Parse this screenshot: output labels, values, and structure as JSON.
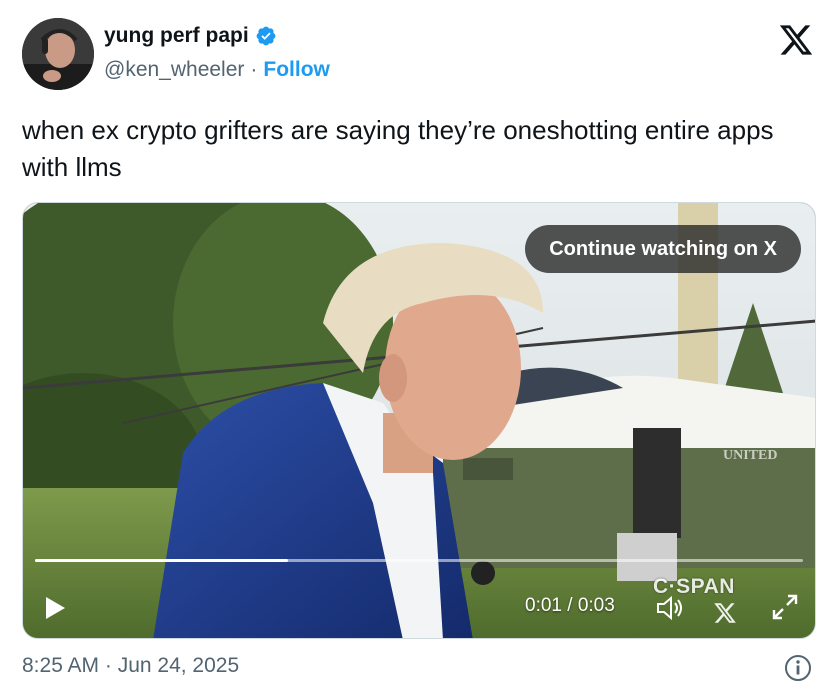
{
  "author": {
    "display_name": "yung perf papi",
    "handle": "@ken_wheeler",
    "separator": "·",
    "follow_label": "Follow",
    "verified": true
  },
  "tweet": {
    "text": "when ex crypto grifters are saying they’re oneshotting entire apps with llms"
  },
  "video": {
    "continue_label": "Continue watching on X",
    "time": "0:01 / 0:03",
    "progress_fraction": 0.33,
    "watermark": "C·SPAN",
    "sign_text": "UNITED"
  },
  "footer": {
    "timestamp": "8:25 AM · Jun 24, 2025"
  },
  "colors": {
    "accent": "#1d9bf0",
    "text": "#0f1419",
    "secondary": "#536471"
  },
  "icons": [
    "verified-badge-icon",
    "x-logo-icon",
    "play-icon",
    "volume-icon",
    "fullscreen-icon",
    "info-icon"
  ]
}
